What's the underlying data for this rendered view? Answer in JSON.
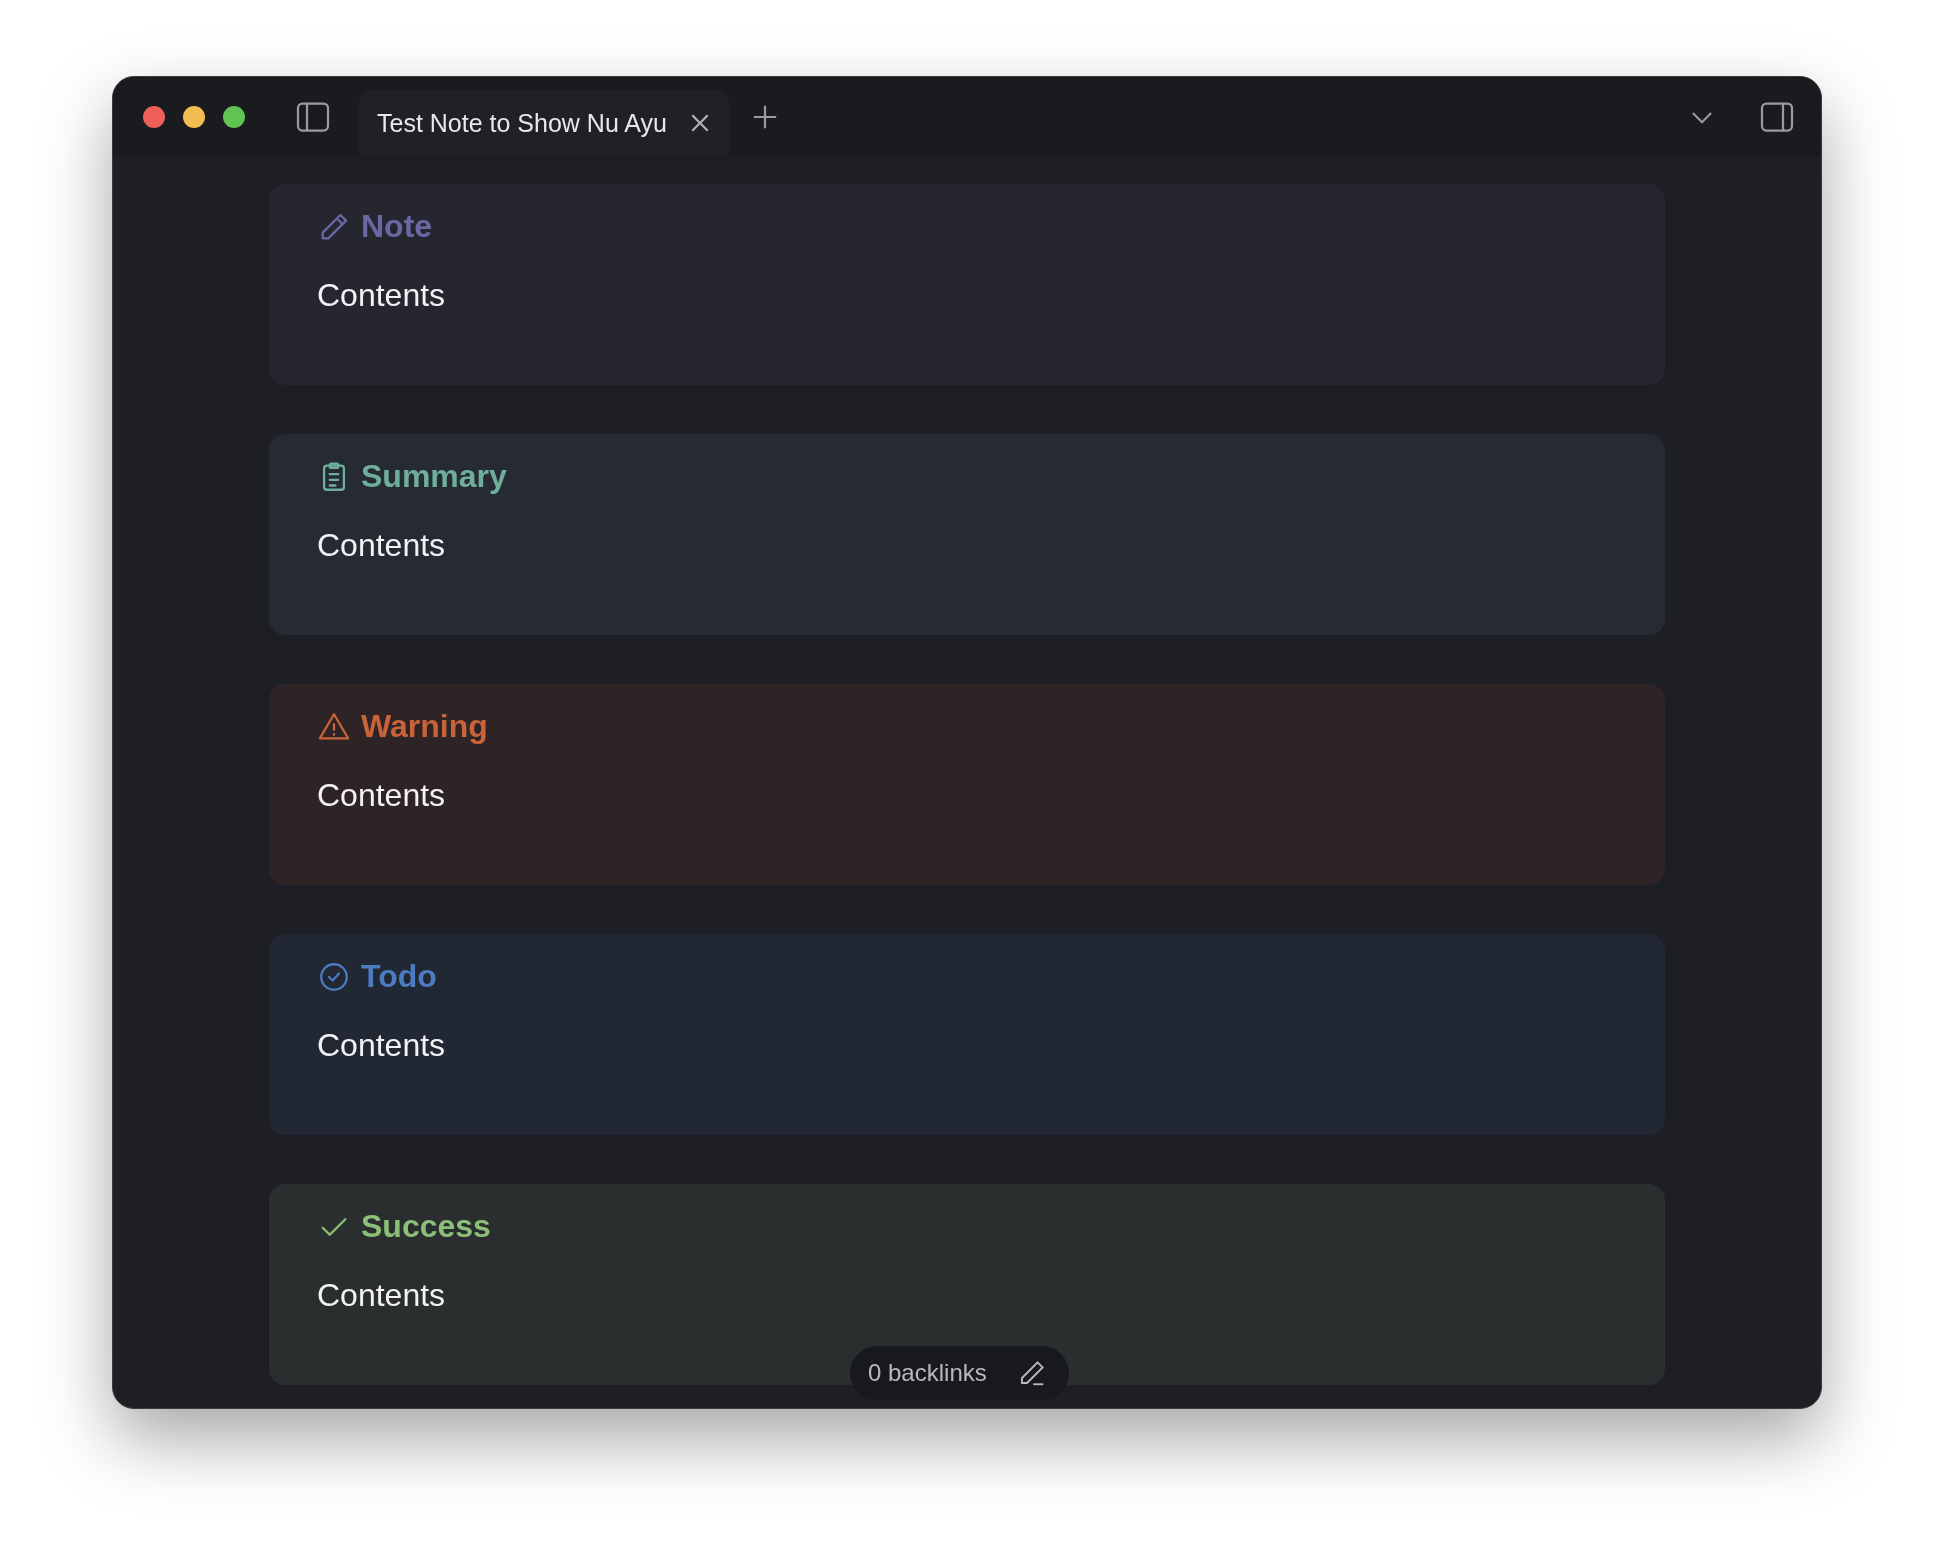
{
  "window": {
    "tabs": [
      {
        "label": "Test Note to Show Nu Ayu",
        "selected": true
      }
    ]
  },
  "callouts": [
    {
      "kind": "note",
      "title": "Note",
      "body": "Contents",
      "color": "#6b67a3"
    },
    {
      "kind": "summary",
      "title": "Summary",
      "body": "Contents",
      "color": "#6fae9a"
    },
    {
      "kind": "warning",
      "title": "Warning",
      "body": "Contents",
      "color": "#c8633a"
    },
    {
      "kind": "todo",
      "title": "Todo",
      "body": "Contents",
      "color": "#4a7cc2"
    },
    {
      "kind": "success",
      "title": "Success",
      "body": "Contents",
      "color": "#8dbf78"
    }
  ],
  "status": {
    "backlinks": "0 backlinks"
  }
}
